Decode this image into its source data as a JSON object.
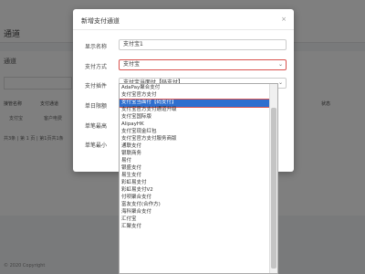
{
  "background": {
    "title": "通道",
    "subtitle": "通道",
    "search_placeholder": "",
    "headers": [
      "接管名称",
      "支付通道",
      "状态"
    ],
    "row": [
      "支付宝",
      "客户电费",
      ""
    ],
    "footer": "共3条 | 第 1 页 | 第1页共1条",
    "copyright": "© 2020 Copyright"
  },
  "modal": {
    "title": "新增支付通道",
    "close_icon": "close-icon",
    "fields": {
      "display_name_label": "显示名称",
      "display_name_value": "支付宝1",
      "pay_method_label": "支付方式",
      "pay_method_value": "支付宝",
      "plugin_label": "支付插件",
      "plugin_value": "支付宝当面付【码支付】",
      "single_min_label": "单日限额",
      "single_max_label": "单笔最高",
      "min_amount_label": "单笔最小"
    }
  },
  "dropdown": {
    "options": [
      "AdaPay聚合支付",
      "支付宝官方支付",
      "支付宝当面付【码支付】",
      "支付宝官方支付通道升级",
      "支付宝国际版",
      "AlipayHK",
      "支付宝现金红包",
      "支付宝官方支付服务商版",
      "通联支付",
      "银联商务",
      "易付",
      "银盛支付",
      "易生支付",
      "彩虹易支付",
      "彩虹易支付V2",
      "付呗聚合支付",
      "富友支付(合作方)",
      "海科聚合支付",
      "汇付宝",
      "汇聚支付"
    ],
    "selected_index": 2
  }
}
